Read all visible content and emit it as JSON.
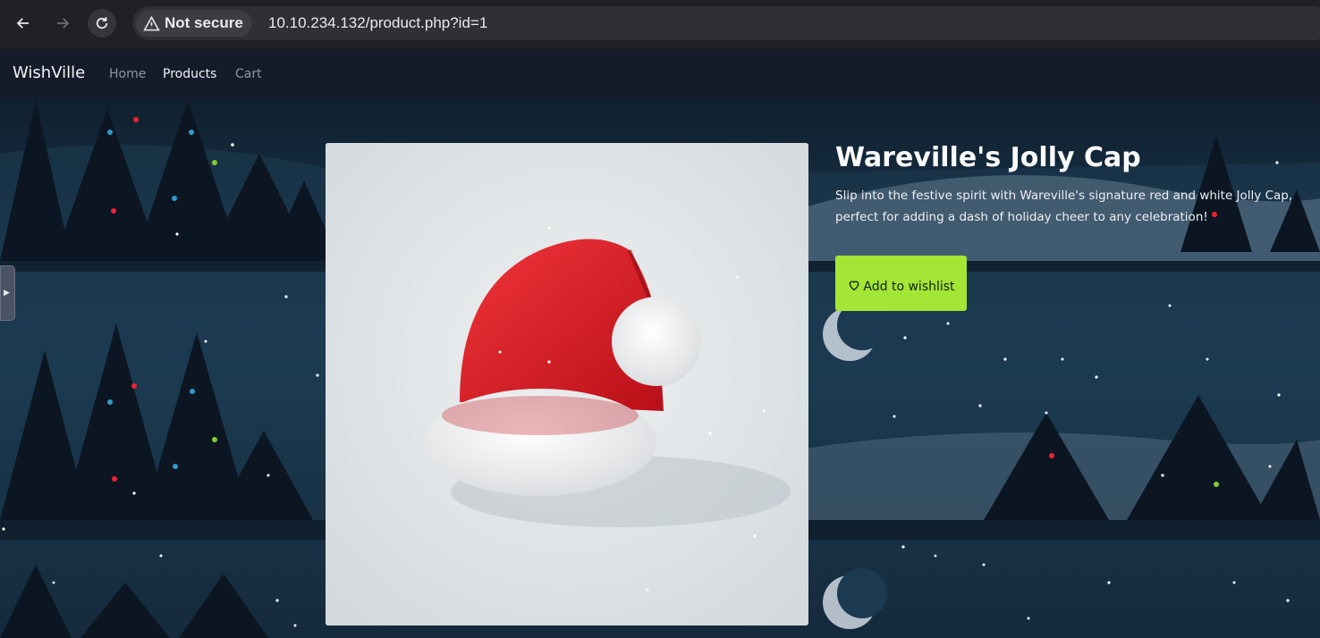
{
  "browser": {
    "security_label": "Not secure",
    "url": "10.10.234.132/product.php?id=1",
    "icons": {
      "back": "arrow-left-icon",
      "forward": "arrow-right-icon",
      "reload": "reload-icon",
      "security": "warning-triangle-icon"
    }
  },
  "nav": {
    "brand": "WishVille",
    "links": [
      "Home",
      "Products",
      "Cart"
    ],
    "active": "Products"
  },
  "product": {
    "title": "Wareville's Jolly Cap",
    "description": "Slip into the festive spirit with Wareville's signature red and white Jolly Cap, perfect for adding a dash of holiday cheer to any celebration!",
    "wishlist_button": "Add to wishlist",
    "wishlist_icon": "heart-icon",
    "image_subject": "santa-hat"
  },
  "colors": {
    "accent": "#a3e635",
    "nav_bg": "#141b29",
    "chrome_bg": "#202124"
  }
}
